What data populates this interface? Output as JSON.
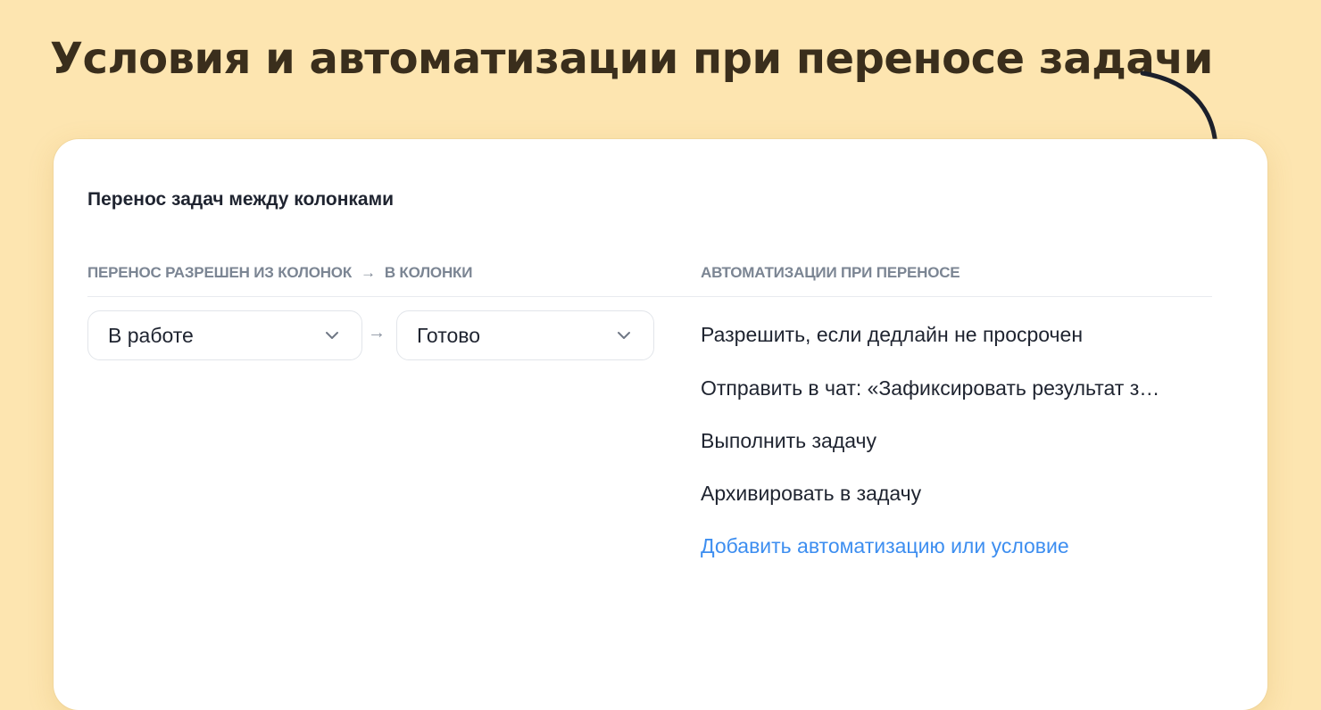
{
  "headline": "Условия и автоматизации при переносе задачи",
  "card": {
    "title": "Перенос задач между колонками",
    "columns": {
      "from_to_label": "ПЕРЕНОС РАЗРЕШЕН ИЗ КОЛОНОК",
      "arrow": "→",
      "to_label": "В КОЛОНКИ",
      "automations_label": "АВТОМАТИЗАЦИИ ПРИ ПЕРЕНОСЕ"
    },
    "transition": {
      "from_value": "В работе",
      "arrow": "→",
      "to_value": "Готово"
    },
    "automations": [
      "Разрешить, если дедлайн не просрочен",
      "Отправить в чат: «Зафиксировать результат з…",
      "Выполнить задачу",
      "Архивировать в задачу"
    ],
    "add_link": "Добавить автоматизацию или условие"
  },
  "colors": {
    "background": "#fde5b0",
    "headline": "#3a2e1c",
    "link": "#3d8ef0",
    "muted": "#7b8593"
  },
  "icons": {
    "select_chevron": "chevron-down-icon",
    "decorative_arrow": "curved-arrow-icon"
  }
}
